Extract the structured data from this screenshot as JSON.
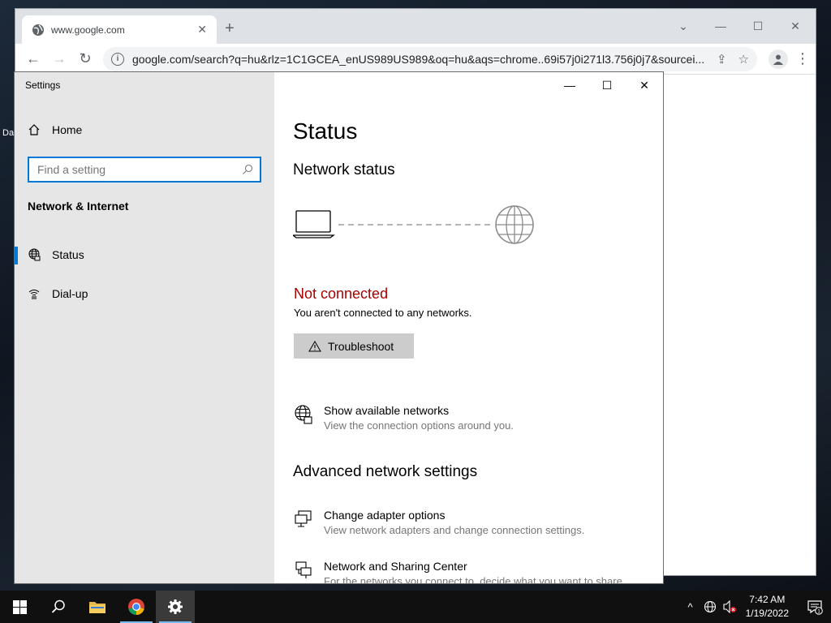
{
  "desktop": {
    "edge_letters": [
      "Da"
    ]
  },
  "browser": {
    "tab_title": "www.google.com",
    "url": "google.com/search?q=hu&rlz=1C1GCEA_enUS989US989&oq=hu&aqs=chrome..69i57j0i271l3.756j0j7&sourcei..."
  },
  "settings": {
    "app_title": "Settings",
    "home_label": "Home",
    "search_placeholder": "Find a setting",
    "section_title": "Network & Internet",
    "nav": [
      {
        "label": "Status",
        "icon": "globe-icon",
        "active": true
      },
      {
        "label": "Dial-up",
        "icon": "dial-up-icon",
        "active": false
      }
    ],
    "page_title": "Status",
    "network_status_heading": "Network status",
    "connection_status": "Not connected",
    "connection_desc": "You aren't connected to any networks.",
    "troubleshoot_label": "Troubleshoot",
    "show_networks": {
      "title": "Show available networks",
      "subtitle": "View the connection options around you."
    },
    "advanced_heading": "Advanced network settings",
    "change_adapter": {
      "title": "Change adapter options",
      "subtitle": "View network adapters and change connection settings."
    },
    "sharing_center": {
      "title": "Network and Sharing Center",
      "subtitle": "For the networks you connect to, decide what you want to share."
    }
  },
  "taskbar": {
    "time": "7:42 AM",
    "date": "1/19/2022",
    "notification_count": "1"
  },
  "colors": {
    "accent": "#0078d7",
    "error": "#a80000",
    "taskbar": "#101010"
  }
}
